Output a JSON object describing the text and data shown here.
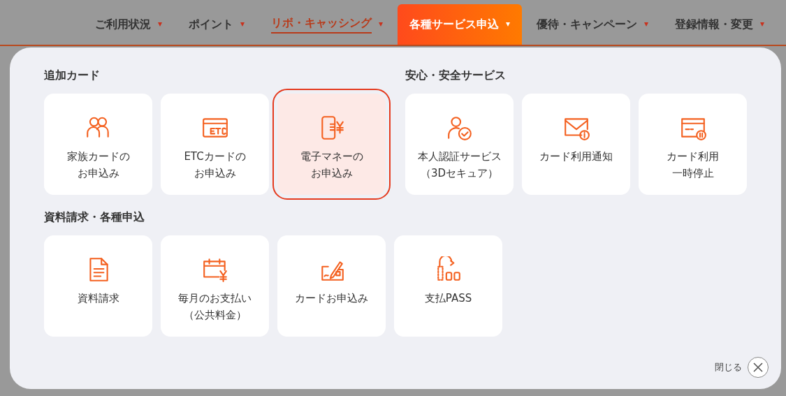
{
  "nav": [
    {
      "label": "ご利用状況",
      "selected": false,
      "underlined": false
    },
    {
      "label": "ポイント",
      "selected": false,
      "underlined": false
    },
    {
      "label": "リボ・キャッシング",
      "selected": false,
      "underlined": true
    },
    {
      "label": "各種サービス申込",
      "selected": true,
      "underlined": false
    },
    {
      "label": "優待・キャンペーン",
      "selected": false,
      "underlined": false
    },
    {
      "label": "登録情報・変更",
      "selected": false,
      "underlined": false
    }
  ],
  "rows": [
    {
      "sections": [
        {
          "title": "追加カード",
          "cards": [
            {
              "lines": [
                "家族カードの",
                "お申込み"
              ],
              "selected": false
            },
            {
              "lines": [
                "ETCカードの",
                "お申込み"
              ],
              "selected": false
            },
            {
              "lines": [
                "電子マネーの",
                "お申込み"
              ],
              "selected": true
            }
          ]
        },
        {
          "title": "安心・安全サービス",
          "cards": [
            {
              "lines": [
                "本人認証サービス",
                "（3Dセキュア）"
              ],
              "selected": false
            },
            {
              "lines": [
                "カード利用通知"
              ],
              "selected": false
            },
            {
              "lines": [
                "カード利用",
                "一時停止"
              ],
              "selected": false
            }
          ]
        }
      ]
    },
    {
      "sections": [
        {
          "title": "資料請求・各種申込",
          "cards": [
            {
              "lines": [
                "資料請求"
              ],
              "selected": false
            },
            {
              "lines": [
                "毎月のお支払い",
                "（公共料金）"
              ],
              "selected": false
            },
            {
              "lines": [
                "カードお申込み"
              ],
              "selected": false
            },
            {
              "lines": [
                "支払PASS"
              ],
              "selected": false
            }
          ]
        }
      ]
    }
  ],
  "close": {
    "label": "閉じる"
  }
}
